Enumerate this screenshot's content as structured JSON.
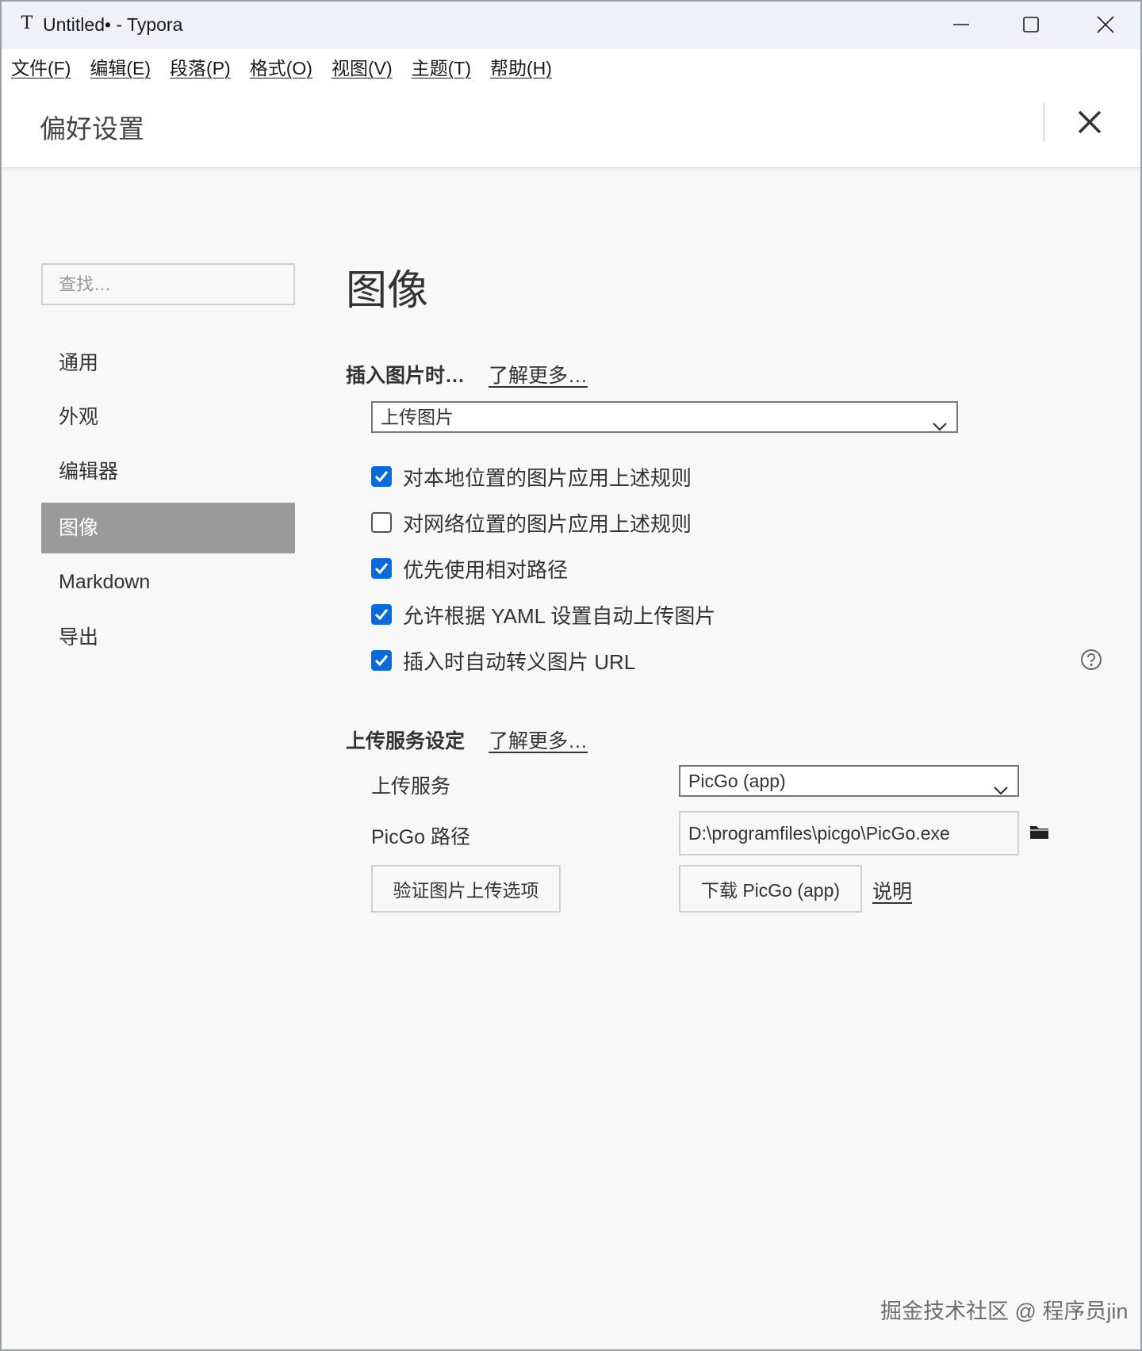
{
  "window": {
    "title": "Untitled• - Typora",
    "app_icon": "T"
  },
  "menu": [
    "文件(F)",
    "编辑(E)",
    "段落(P)",
    "格式(O)",
    "视图(V)",
    "主题(T)",
    "帮助(H)"
  ],
  "preferences": {
    "title": "偏好设置"
  },
  "sidebar": {
    "search_placeholder": "查找…",
    "items": [
      {
        "label": "通用",
        "active": false
      },
      {
        "label": "外观",
        "active": false
      },
      {
        "label": "编辑器",
        "active": false
      },
      {
        "label": "图像",
        "active": true
      },
      {
        "label": "Markdown",
        "active": false
      },
      {
        "label": "导出",
        "active": false
      }
    ]
  },
  "main": {
    "section_title": "图像",
    "insert": {
      "label": "插入图片时…",
      "learn_more": "了解更多…",
      "select_value": "上传图片",
      "options": [
        {
          "label": "对本地位置的图片应用上述规则",
          "checked": true
        },
        {
          "label": "对网络位置的图片应用上述规则",
          "checked": false
        },
        {
          "label": "优先使用相对路径",
          "checked": true
        },
        {
          "label": "允许根据 YAML 设置自动上传图片",
          "checked": true
        },
        {
          "label": "插入时自动转义图片 URL",
          "checked": true
        }
      ]
    },
    "upload": {
      "label": "上传服务设定",
      "learn_more": "了解更多…",
      "service_label": "上传服务",
      "service_value": "PicGo (app)",
      "path_label": "PicGo 路径",
      "path_value": "D:\\programfiles\\picgo\\PicGo.exe",
      "verify_button": "验证图片上传选项",
      "download_button": "下载 PicGo (app)",
      "doc_link": "说明"
    }
  },
  "watermark": "掘金技术社区 @ 程序员jin",
  "colors": {
    "accent": "#0a6ad7",
    "active_nav": "#9a9a9a"
  }
}
